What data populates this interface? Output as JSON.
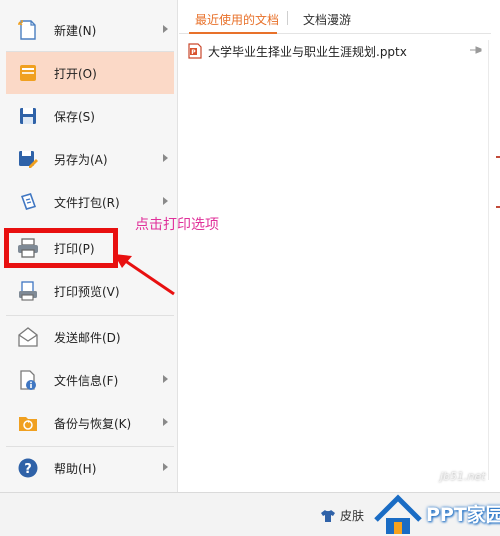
{
  "menu": {
    "items": [
      {
        "label": "新建(N)",
        "icon": "new-file-icon",
        "has_submenu": true
      },
      {
        "label": "打开(O)",
        "icon": "open-folder-icon",
        "has_submenu": false,
        "active": true
      },
      {
        "label": "保存(S)",
        "icon": "save-icon",
        "has_submenu": false
      },
      {
        "label": "另存为(A)",
        "icon": "save-as-icon",
        "has_submenu": true
      },
      {
        "label": "文件打包(R)",
        "icon": "package-icon",
        "has_submenu": true
      },
      {
        "label": "打印(P)",
        "icon": "printer-icon",
        "has_submenu": false
      },
      {
        "label": "打印预览(V)",
        "icon": "print-preview-icon",
        "has_submenu": false
      },
      {
        "label": "发送邮件(D)",
        "icon": "email-icon",
        "has_submenu": false
      },
      {
        "label": "文件信息(F)",
        "icon": "file-info-icon",
        "has_submenu": true
      },
      {
        "label": "备份与恢复(K)",
        "icon": "backup-icon",
        "has_submenu": true
      },
      {
        "label": "帮助(H)",
        "icon": "help-icon",
        "has_submenu": true
      }
    ]
  },
  "tabs": {
    "recent_label": "最近使用的文档",
    "roam_label": "文档漫游"
  },
  "recent_files": [
    {
      "name": "大学毕业生择业与职业生涯规划.pptx",
      "icon": "pptx-file-icon"
    }
  ],
  "bottom": {
    "skin_label": "皮肤"
  },
  "annotation": {
    "text": "点击打印选项"
  },
  "watermark": {
    "url": "jb51.net",
    "text": "PPT家园"
  },
  "colors": {
    "accent": "#e8712a",
    "active_bg": "#fbd9c7",
    "highlight_red": "#e81010",
    "annotation_pink": "#e0309a"
  }
}
